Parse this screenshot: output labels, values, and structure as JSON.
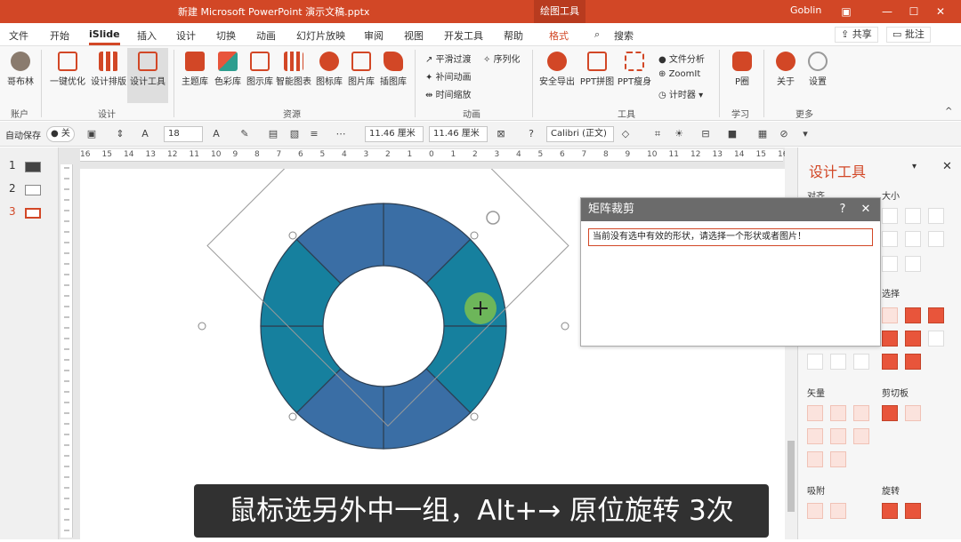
{
  "titlebar": {
    "title": "新建 Microsoft PowerPoint 演示文稿.pptx",
    "context_tab": "绘图工具",
    "user": "Goblin"
  },
  "menu": {
    "items": [
      "文件",
      "开始",
      "iSlide",
      "插入",
      "设计",
      "切换",
      "动画",
      "幻灯片放映",
      "审阅",
      "视图",
      "开发工具",
      "帮助",
      "格式"
    ],
    "search": "搜索",
    "share": "共享",
    "comment": "批注"
  },
  "ribbon": {
    "account": {
      "label": "哥布林",
      "group": "账户"
    },
    "design_buttons": [
      "一键优化",
      "设计排版",
      "设计工具"
    ],
    "design_group": "设计",
    "resource_buttons": [
      "主题库",
      "色彩库",
      "图示库",
      "智能图表",
      "图标库",
      "图片库",
      "插图库"
    ],
    "resource_group": "资源",
    "anim_items": [
      "平滑过渡",
      "补间动画",
      "时间缩放",
      "序列化"
    ],
    "anim_group": "动画",
    "tool_buttons": [
      "安全导出",
      "PPT拼图",
      "PPT瘦身"
    ],
    "tool_small": [
      "文件分析",
      "ZoomIt",
      "计时器"
    ],
    "tool_group": "工具",
    "learn_button": "P圈",
    "learn_group": "学习",
    "more_buttons": [
      "关于",
      "设置"
    ],
    "more_group": "更多"
  },
  "toolbar": {
    "autosave": "自动保存",
    "autosave_state": "关",
    "font_size": "18",
    "width": "11.46 厘米",
    "height": "11.46 厘米",
    "font_name": "Calibri (正文)"
  },
  "thumbnails": [
    "1",
    "2",
    "3"
  ],
  "ruler": {
    "ticks": [
      "16",
      "15",
      "14",
      "13",
      "12",
      "11",
      "10",
      "9",
      "8",
      "7",
      "6",
      "5",
      "4",
      "3",
      "2",
      "1",
      "0",
      "1",
      "2",
      "3",
      "4",
      "5",
      "6",
      "7",
      "8",
      "9",
      "10",
      "11",
      "12",
      "13",
      "14",
      "15",
      "16"
    ]
  },
  "right_pane": {
    "title": "设计工具",
    "sections": [
      "对齐",
      "大小",
      "选择",
      "矢量",
      "剪切板",
      "吸附",
      "旋转"
    ]
  },
  "dialog": {
    "title": "矩阵裁剪",
    "message": "当前没有选中有效的形状，请选择一个形状或者图片！"
  },
  "subtitle": "鼠标选另外中一组，Alt+→ 原位旋转 3次",
  "colors": {
    "accent": "#d24726",
    "ring_blue": "#3a6ea5",
    "ring_teal": "#16809e"
  }
}
